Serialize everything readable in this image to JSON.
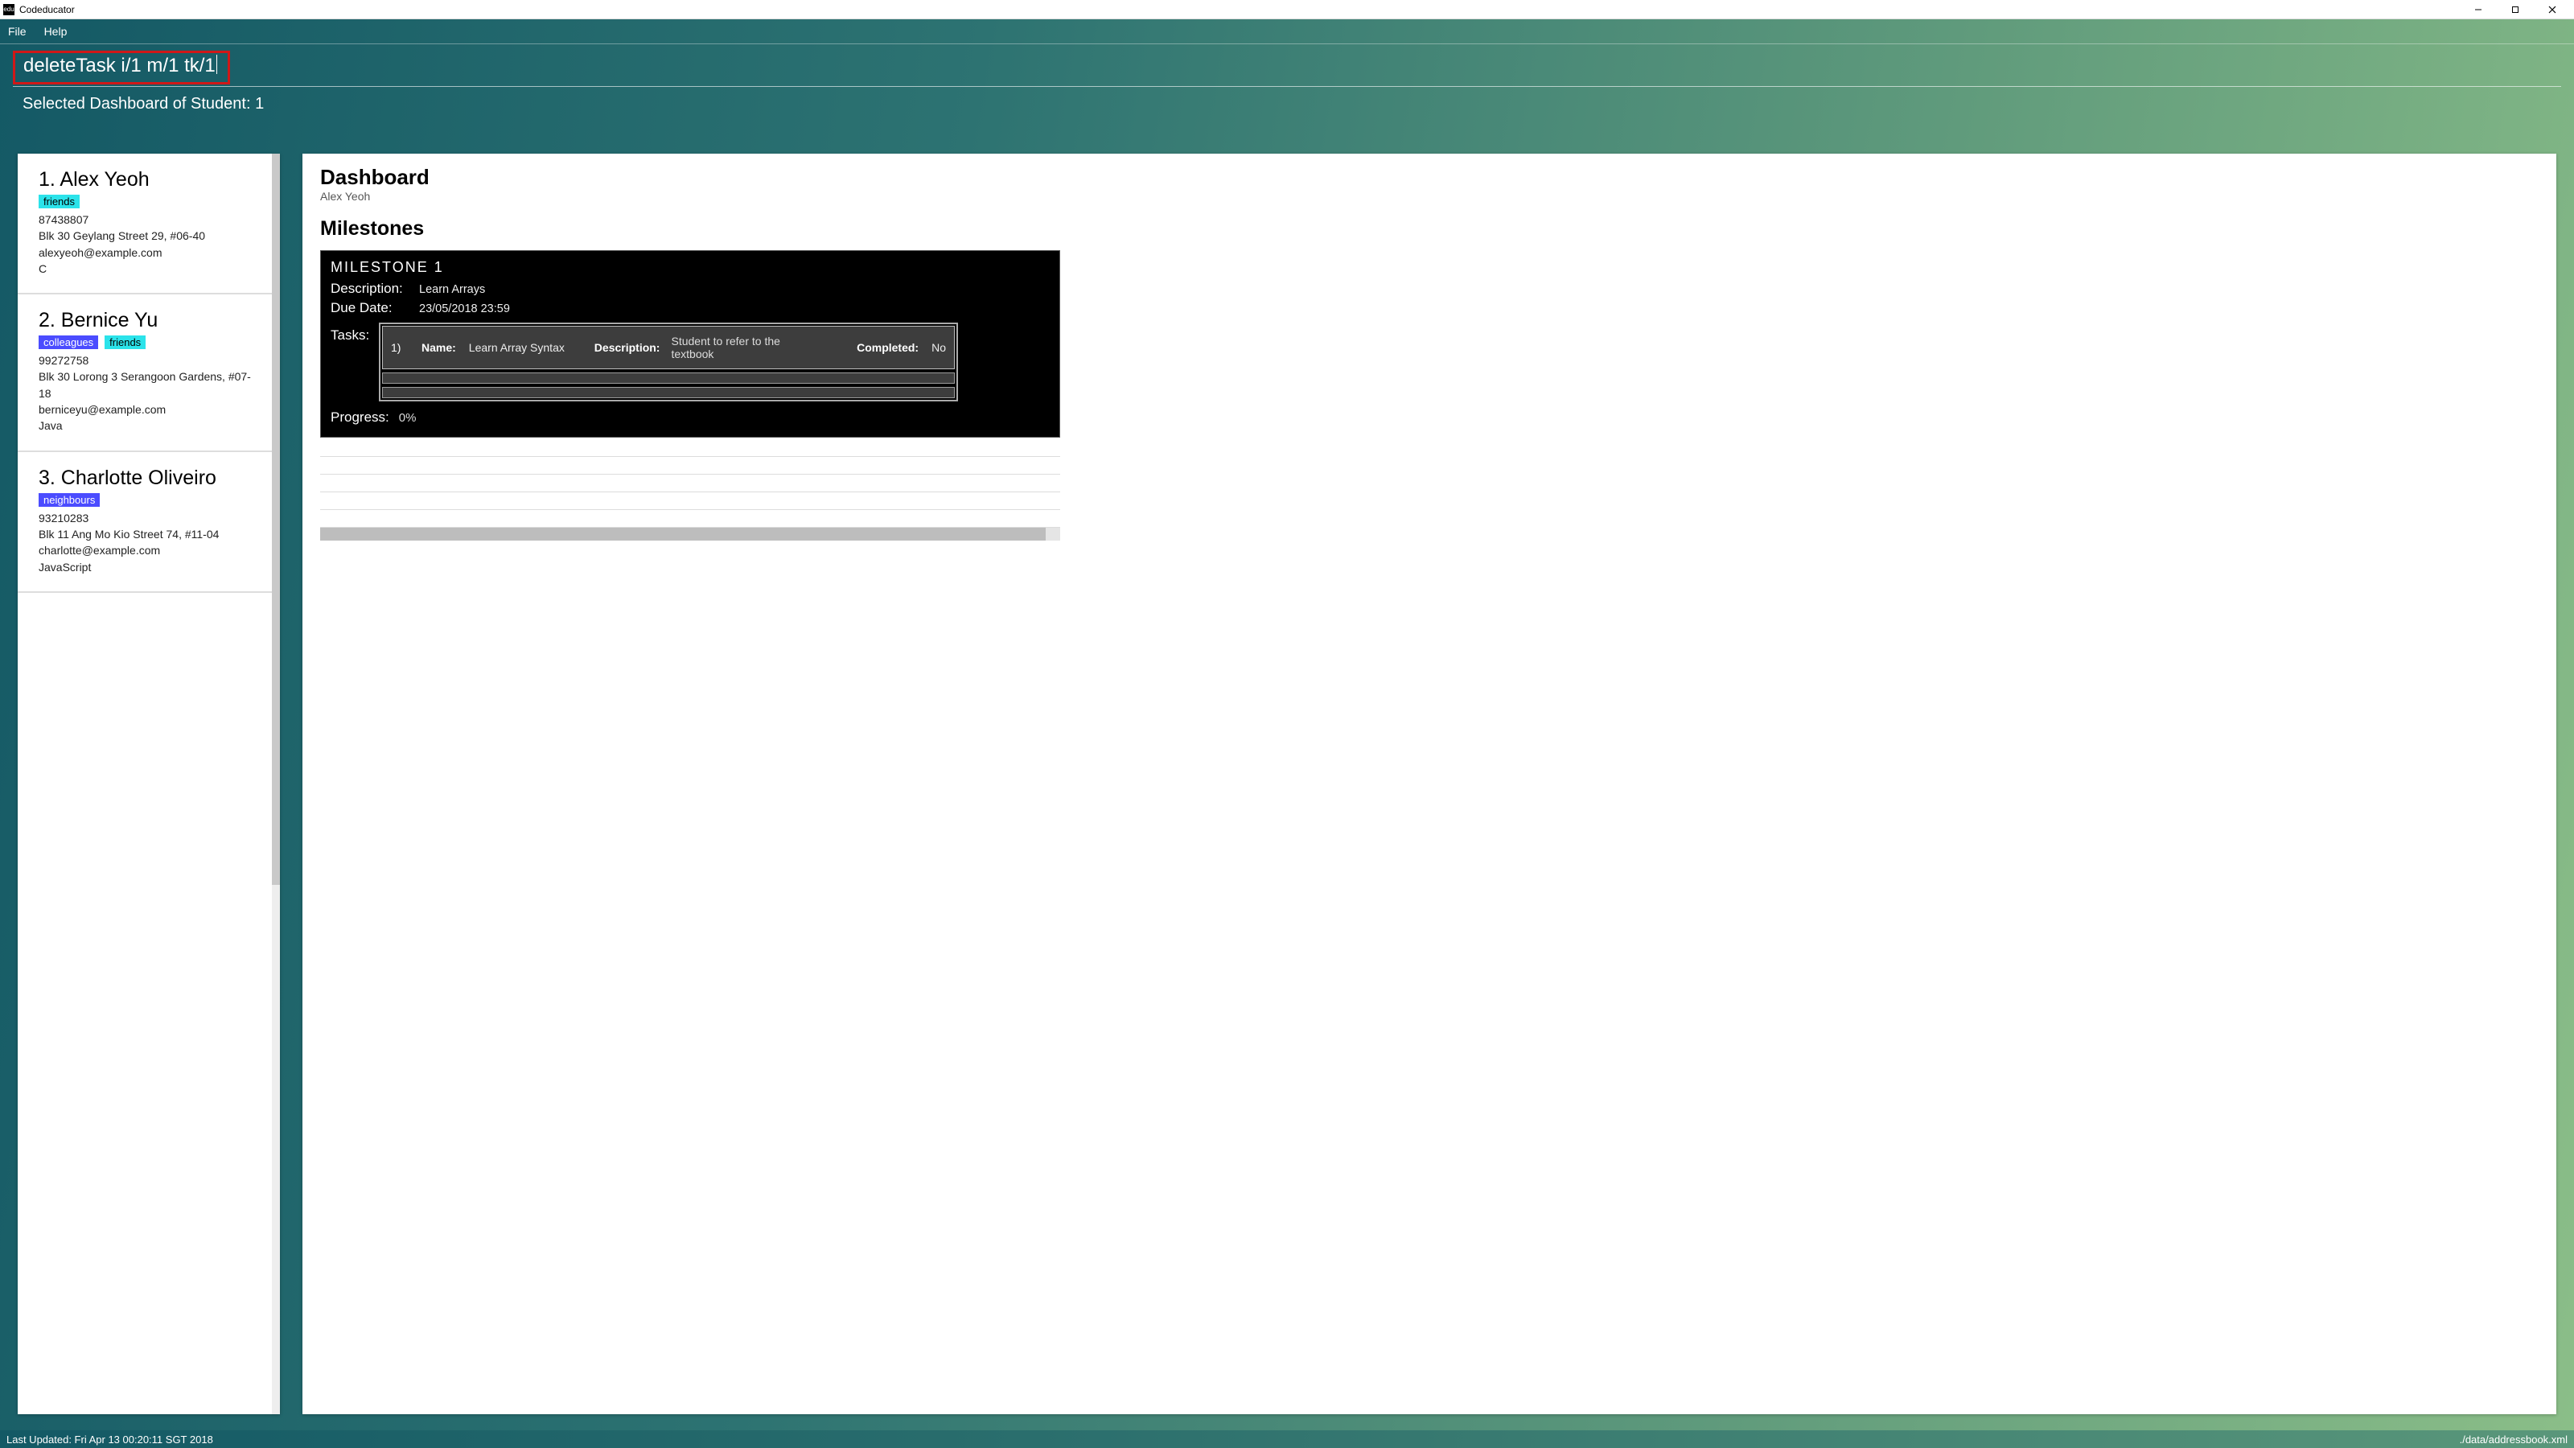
{
  "window": {
    "title": "Codeducator",
    "icon_text": "edu"
  },
  "menubar": {
    "file": "File",
    "help": "Help"
  },
  "command_input": {
    "value": "deleteTask i/1 m/1 tk/1"
  },
  "status_line": "Selected Dashboard of Student: 1",
  "students": [
    {
      "index": "1.",
      "name": "Alex Yeoh",
      "tags": [
        {
          "label": "friends",
          "cls": "friends"
        }
      ],
      "phone": "87438807",
      "address": "Blk 30 Geylang Street 29, #06-40",
      "email": "alexyeoh@example.com",
      "lang": "C"
    },
    {
      "index": "2.",
      "name": "Bernice Yu",
      "tags": [
        {
          "label": "colleagues",
          "cls": "colleagues"
        },
        {
          "label": "friends",
          "cls": "friends"
        }
      ],
      "phone": "99272758",
      "address": "Blk 30 Lorong 3 Serangoon Gardens, #07-18",
      "email": "berniceyu@example.com",
      "lang": "Java"
    },
    {
      "index": "3.",
      "name": "Charlotte Oliveiro",
      "tags": [
        {
          "label": "neighbours",
          "cls": "neighbours"
        }
      ],
      "phone": "93210283",
      "address": "Blk 11 Ang Mo Kio Street 74, #11-04",
      "email": "charlotte@example.com",
      "lang": "JavaScript"
    }
  ],
  "dashboard": {
    "title": "Dashboard",
    "subtitle": "Alex Yeoh",
    "section": "Milestones",
    "milestone": {
      "title": "MILESTONE 1",
      "desc_label": "Description:",
      "desc_value": "Learn Arrays",
      "due_label": "Due Date:",
      "due_value": "23/05/2018 23:59",
      "tasks_label": "Tasks:",
      "task": {
        "idx": "1)",
        "name_label": "Name:",
        "name_value": "Learn Array Syntax",
        "desc_label": "Description:",
        "desc_value": "Student to refer to the textbook",
        "comp_label": "Completed:",
        "comp_value": "No"
      },
      "progress_label": "Progress:",
      "progress_value": "0%"
    }
  },
  "footer": {
    "left": "Last Updated: Fri Apr 13 00:20:11 SGT 2018",
    "right": "./data/addressbook.xml"
  }
}
